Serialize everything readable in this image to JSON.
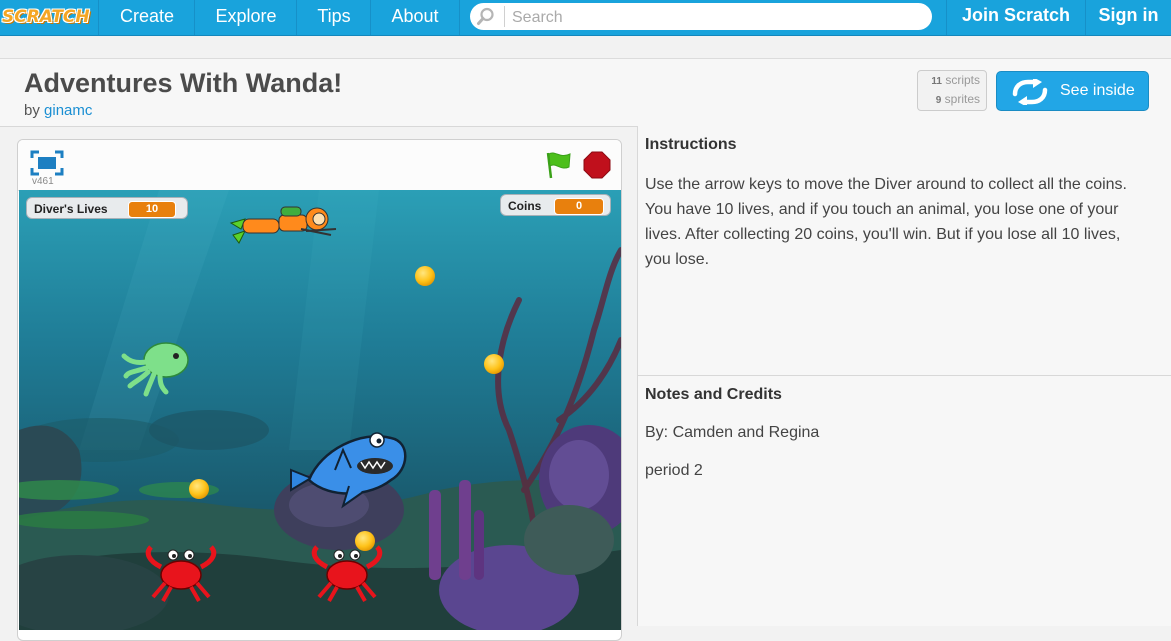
{
  "nav": {
    "logo": "SCRATCH",
    "create": "Create",
    "explore": "Explore",
    "tips": "Tips",
    "about": "About",
    "search_placeholder": "Search",
    "join": "Join Scratch",
    "signin": "Sign in"
  },
  "project": {
    "title": "Adventures With Wanda!",
    "by": "by",
    "author": "ginamc",
    "scripts_count": "11",
    "scripts_label": "scripts",
    "sprites_count": "9",
    "sprites_label": "sprites",
    "see_inside": "See inside"
  },
  "player": {
    "version": "v461",
    "monitors": {
      "lives_label": "Diver's Lives",
      "lives_value": "10",
      "coins_label": "Coins",
      "coins_value": "0"
    }
  },
  "instructions": {
    "heading": "Instructions",
    "text": "Use the arrow keys to move the Diver around to collect all the coins. You have 10 lives, and if you touch an animal, you lose one of your lives. After collecting 20 coins, you'll win. But if you lose all 10 lives, you lose."
  },
  "notes": {
    "heading": "Notes and Credits",
    "line1": "By: Camden and Regina",
    "line2": "period 2"
  },
  "colors": {
    "nav_blue": "#19a3dc",
    "button_blue": "#22a6e6",
    "link_blue": "#1b8fd3",
    "monitor_orange": "#e8800d"
  }
}
